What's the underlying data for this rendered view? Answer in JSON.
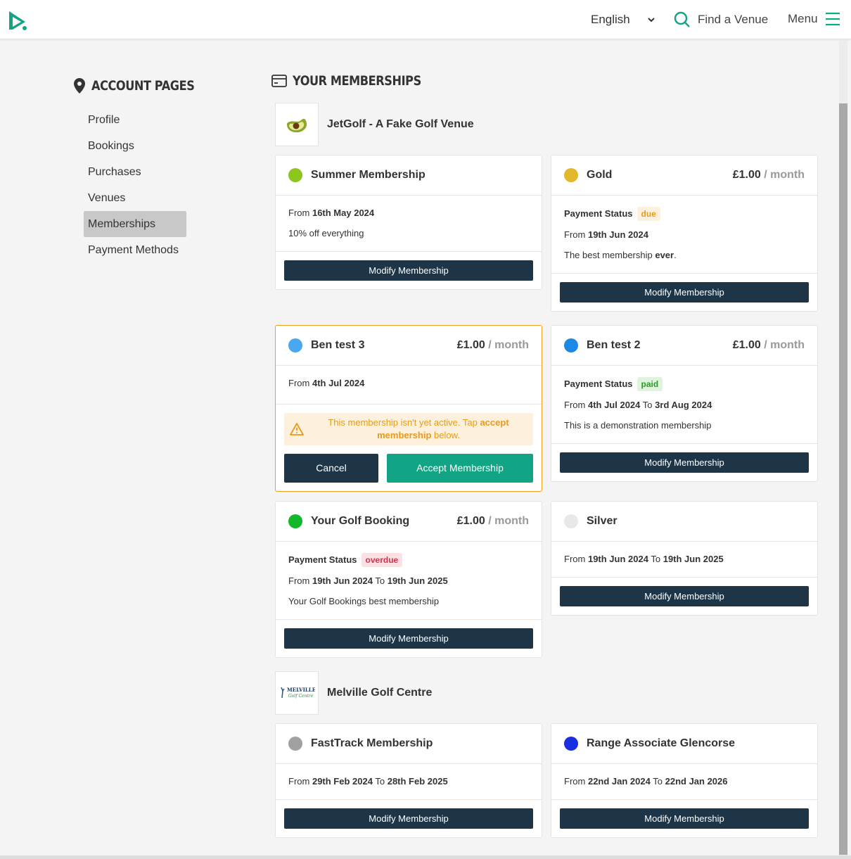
{
  "header": {
    "language": "English",
    "find_venue": "Find a Venue",
    "menu": "Menu",
    "accent_color": "#12a585"
  },
  "sidebar": {
    "title": "ACCOUNT PAGES",
    "items": [
      {
        "label": "Profile"
      },
      {
        "label": "Bookings"
      },
      {
        "label": "Purchases"
      },
      {
        "label": "Venues"
      },
      {
        "label": "Memberships",
        "active": true
      },
      {
        "label": "Payment Methods"
      }
    ]
  },
  "main": {
    "title": "YOUR MEMBERSHIPS",
    "venues": [
      {
        "name": "JetGolf - A Fake Golf Venue"
      },
      {
        "name": "Melville Golf Centre",
        "logo_text": "MELVILLE",
        "logo_subtext": "Golf Centre"
      }
    ]
  },
  "cards": {
    "summer": {
      "name": "Summer Membership",
      "color": "#8cc61e",
      "from_label": "From",
      "from": "16th May 2024",
      "description": "10% off everything",
      "button": "Modify Membership"
    },
    "gold": {
      "name": "Gold",
      "color": "#e2b82a",
      "price": "£1.00",
      "per": "/ month",
      "status_label": "Payment Status",
      "status": "due",
      "from_label": "From",
      "from": "19th Jun 2024",
      "description_pre": "The best membership ",
      "description_bold": "ever",
      "description_post": ".",
      "button": "Modify Membership"
    },
    "ben3": {
      "name": "Ben test 3",
      "color": "#4aa8f0",
      "price": "£1.00",
      "per": "/ month",
      "from_label": "From",
      "from": "4th Jul 2024",
      "warning_pre": "This membership isn't yet active. Tap ",
      "warning_bold": "accept membership",
      "warning_post": " below.",
      "cancel": "Cancel",
      "accept": "Accept Membership"
    },
    "ben2": {
      "name": "Ben test 2",
      "color": "#1e88e5",
      "price": "£1.00",
      "per": "/ month",
      "status_label": "Payment Status",
      "status": "paid",
      "from_label": "From",
      "from": "4th Jul 2024",
      "to_label": "To",
      "to": "3rd Aug 2024",
      "description": "This is a demonstration membership",
      "button": "Modify Membership"
    },
    "yourgolf": {
      "name": "Your Golf Booking",
      "color": "#12b82a",
      "price": "£1.00",
      "per": "/ month",
      "status_label": "Payment Status",
      "status": "overdue",
      "from_label": "From",
      "from": "19th Jun 2024",
      "to_label": "To",
      "to": "19th Jun 2025",
      "description": "Your Golf Bookings best membership",
      "button": "Modify Membership"
    },
    "silver": {
      "name": "Silver",
      "color": "#e8e8e8",
      "from_label": "From",
      "from": "19th Jun 2024",
      "to_label": "To",
      "to": "19th Jun 2025",
      "button": "Modify Membership"
    },
    "fasttrack": {
      "name": "FastTrack Membership",
      "color": "#a0a0a0",
      "from_label": "From",
      "from": "29th Feb 2024",
      "to_label": "To",
      "to": "28th Feb 2025",
      "button": "Modify Membership"
    },
    "range": {
      "name": "Range Associate Glencorse",
      "color": "#1a2fe0",
      "from_label": "From",
      "from": "22nd Jan 2024",
      "to_label": "To",
      "to": "22nd Jan 2026",
      "button": "Modify Membership"
    }
  }
}
